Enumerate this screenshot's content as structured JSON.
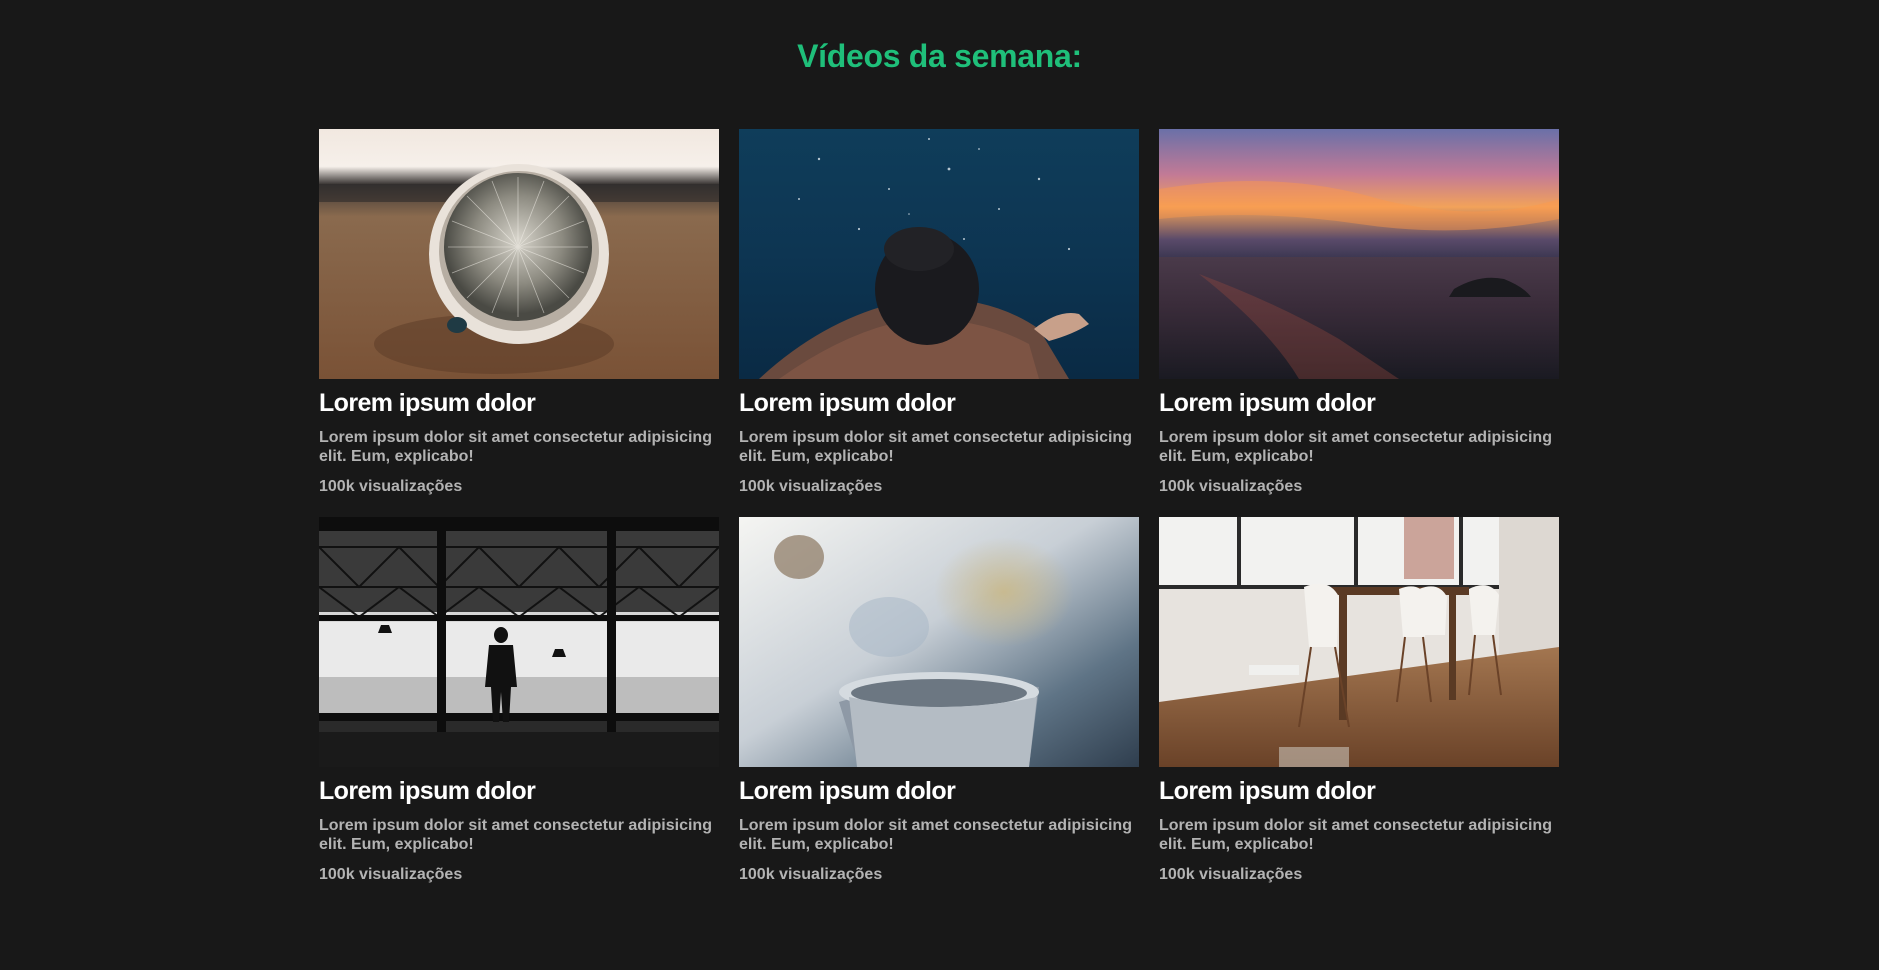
{
  "page": {
    "title": "Vídeos da semana:"
  },
  "videos": [
    {
      "thumbnail": "cactus-pot-photo",
      "title": "Lorem ipsum dolor",
      "description": "Lorem ipsum dolor sit amet consectetur adipisicing elit. Eum, explicabo!",
      "views": "100k visualizações"
    },
    {
      "thumbnail": "underwater-swimmer-photo",
      "title": "Lorem ipsum dolor",
      "description": "Lorem ipsum dolor sit amet consectetur adipisicing elit. Eum, explicabo!",
      "views": "100k visualizações"
    },
    {
      "thumbnail": "ocean-sunset-photo",
      "title": "Lorem ipsum dolor",
      "description": "Lorem ipsum dolor sit amet consectetur adipisicing elit. Eum, explicabo!",
      "views": "100k visualizações"
    },
    {
      "thumbnail": "hangar-silhouette-photo",
      "title": "Lorem ipsum dolor",
      "description": "Lorem ipsum dolor sit amet consectetur adipisicing elit. Eum, explicabo!",
      "views": "100k visualizações"
    },
    {
      "thumbnail": "steaming-mug-photo",
      "title": "Lorem ipsum dolor",
      "description": "Lorem ipsum dolor sit amet consectetur adipisicing elit. Eum, explicabo!",
      "views": "100k visualizações"
    },
    {
      "thumbnail": "dining-room-photo",
      "title": "Lorem ipsum dolor",
      "description": "Lorem ipsum dolor sit amet consectetur adipisicing elit. Eum, explicabo!",
      "views": "100k visualizações"
    }
  ],
  "colors": {
    "background": "#181818",
    "accent": "#1fbf7a",
    "title": "#ffffff",
    "text": "#b3b3b3"
  }
}
